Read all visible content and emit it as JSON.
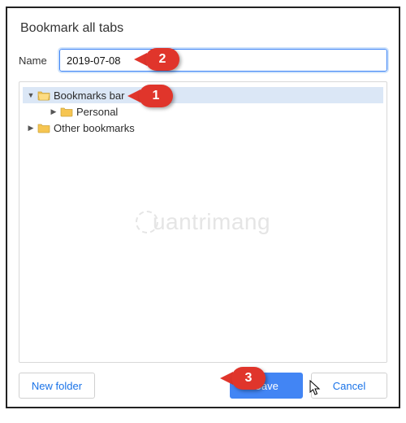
{
  "dialog": {
    "title": "Bookmark all tabs",
    "name_label": "Name",
    "name_value": "2019-07-08"
  },
  "tree": {
    "items": [
      {
        "label": "Bookmarks bar",
        "depth": 0,
        "expanded": true,
        "open": true,
        "selected": true
      },
      {
        "label": "Personal",
        "depth": 1,
        "expanded": null,
        "open": false,
        "selected": false
      },
      {
        "label": "Other bookmarks",
        "depth": 0,
        "expanded": false,
        "open": false,
        "selected": false
      }
    ]
  },
  "buttons": {
    "new_folder": "New folder",
    "save": "Save",
    "cancel": "Cancel"
  },
  "watermark": "uantrimang",
  "callouts": {
    "c1": "1",
    "c2": "2",
    "c3": "3"
  }
}
